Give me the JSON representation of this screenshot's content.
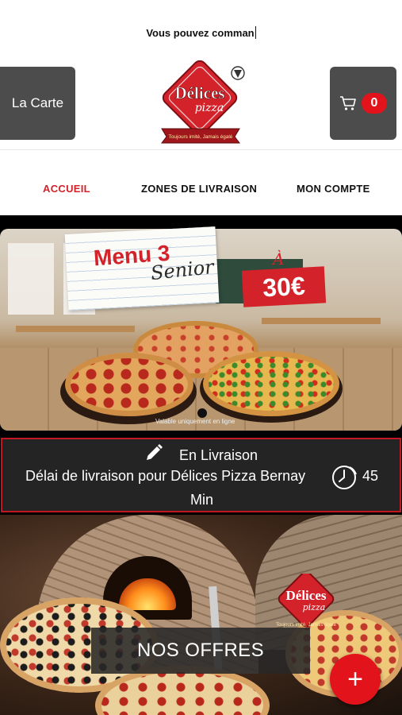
{
  "ticker": {
    "text": "Vous pouvez comman"
  },
  "header": {
    "menu_button_label": "La Carte",
    "cart_count": "0",
    "cart_icon": "cart-icon",
    "logo": {
      "brand": "Délices",
      "subbrand": "pizza",
      "tagline": "Toujours imité, Jamais égalé"
    }
  },
  "nav": {
    "tabs": [
      {
        "label": "ACCUEIL",
        "active": true
      },
      {
        "label": "ZONES DE LIVRAISON",
        "active": false
      },
      {
        "label": "MON COMPTE",
        "active": false
      }
    ]
  },
  "banner": {
    "menu_title": "Menu 3",
    "menu_subtitle": "Senior",
    "price_prefix": "À",
    "price": "30€",
    "disclaimer": "Valable uniquement en ligne"
  },
  "delivery": {
    "mode": "En Livraison",
    "delay_text": "Délai de livraison pour Délices Pizza Bernay",
    "delay_value": "45",
    "delay_unit": "Min",
    "edit_icon": "pencil-icon",
    "clock_icon": "clock-icon"
  },
  "offers": {
    "label": "NOS OFFRES"
  },
  "fab": {
    "label": "+"
  },
  "colors": {
    "accent_red": "#e3131b",
    "active_tab": "#d3222a",
    "dark_button": "#4c4c4c",
    "panel_bg": "#242424"
  }
}
